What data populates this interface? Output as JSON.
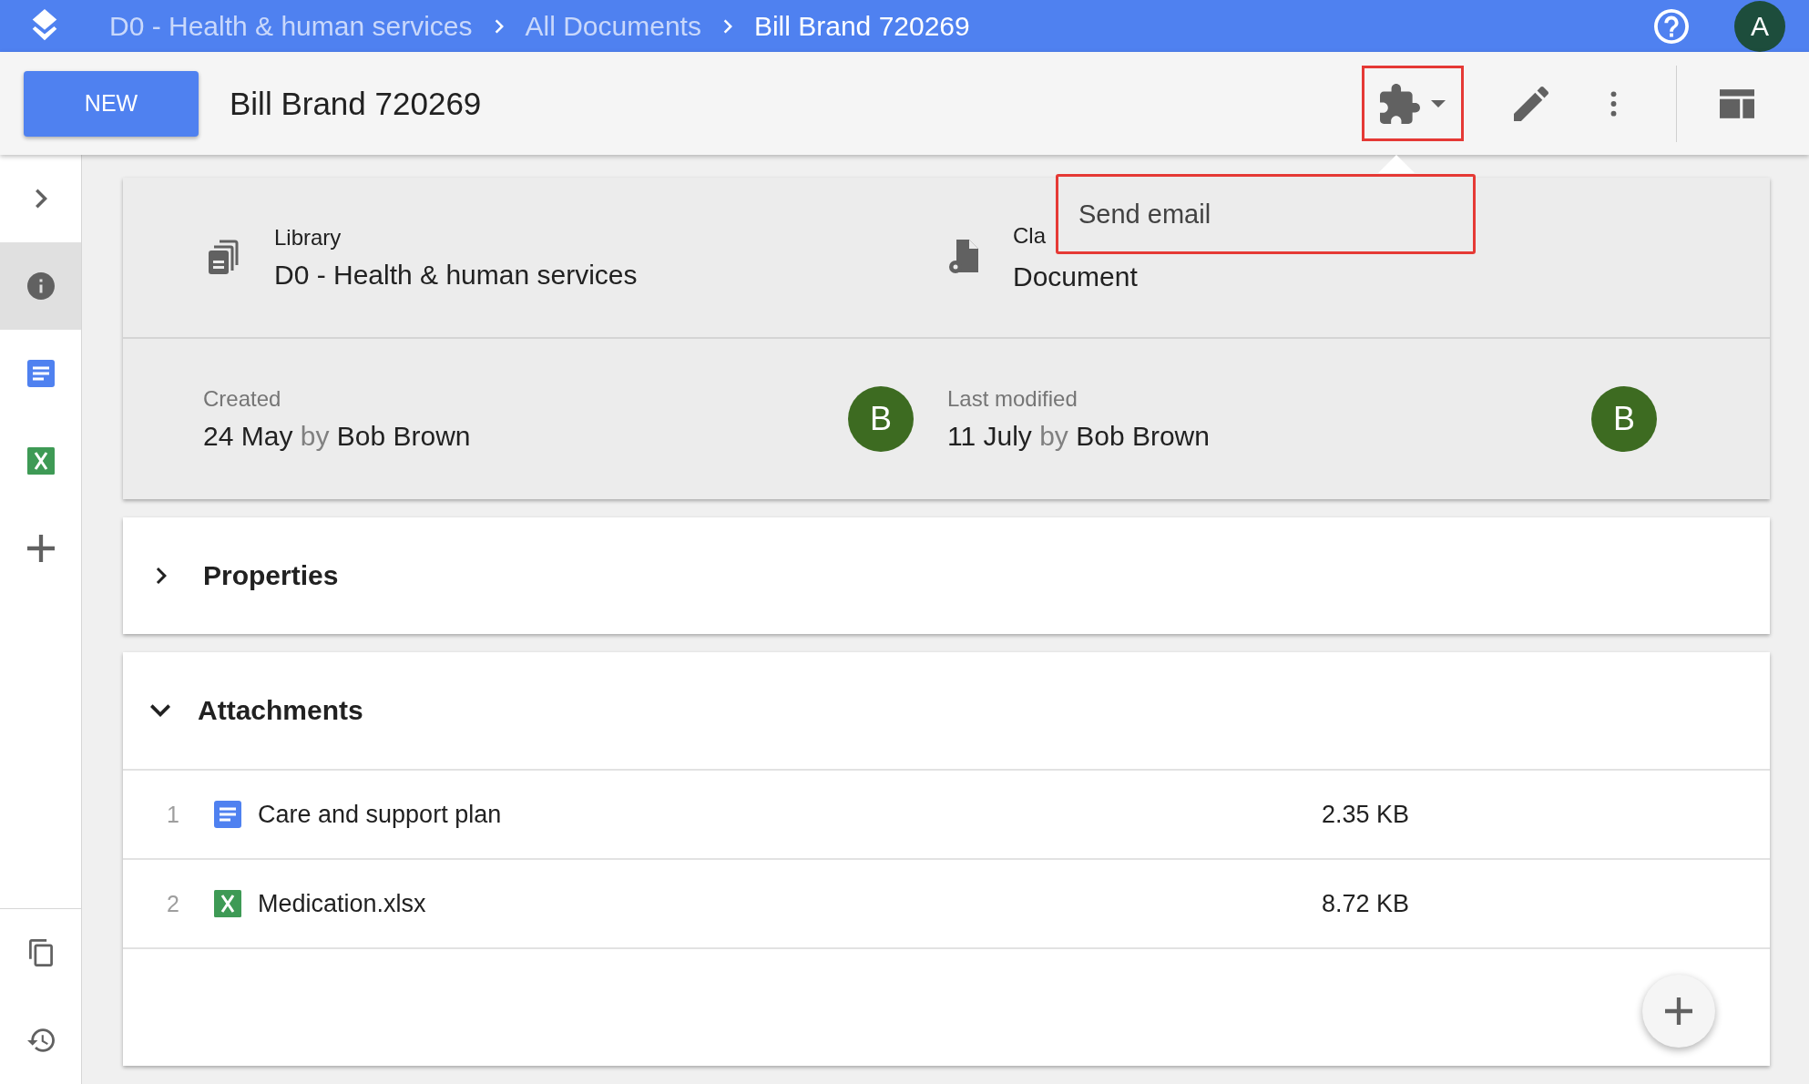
{
  "app_bar": {
    "breadcrumbs": [
      {
        "label": "D0 - Health & human services",
        "current": false
      },
      {
        "label": "All Documents",
        "current": false
      },
      {
        "label": "Bill Brand 720269",
        "current": true
      }
    ],
    "account_avatar": "A"
  },
  "toolbar": {
    "new_button": "NEW",
    "title": "Bill Brand 720269"
  },
  "actions_menu": {
    "items": [
      "Send email"
    ]
  },
  "sidebar": {
    "items": [
      {
        "kind": "expand",
        "selected": false
      },
      {
        "kind": "info",
        "selected": true
      },
      {
        "kind": "document",
        "selected": false
      },
      {
        "kind": "spreadsheet",
        "selected": false
      },
      {
        "kind": "add",
        "selected": false
      }
    ],
    "bottom_items": [
      {
        "kind": "copy",
        "selected": false
      },
      {
        "kind": "history",
        "selected": false
      }
    ]
  },
  "info_card": {
    "fields": [
      {
        "kind": "library",
        "label": "Library",
        "value": "D0 - Health & human services"
      },
      {
        "kind": "class",
        "label": "Cla",
        "value": "Document"
      }
    ],
    "history": [
      {
        "label": "Created",
        "date": "24 May",
        "by": "by",
        "user": "Bob Brown",
        "avatar": "B"
      },
      {
        "label": "Last modified",
        "date": "11 July",
        "by": "by",
        "user": "Bob Brown",
        "avatar": "B"
      }
    ]
  },
  "sections": [
    {
      "title": "Properties",
      "expanded": false
    },
    {
      "title": "Attachments",
      "expanded": true,
      "rows": [
        {
          "index": "1",
          "kind": "document",
          "name": "Care and support plan",
          "size": "2.35 KB"
        },
        {
          "index": "2",
          "kind": "spreadsheet",
          "name": "Medication.xlsx",
          "size": "8.72 KB"
        }
      ]
    }
  ]
}
